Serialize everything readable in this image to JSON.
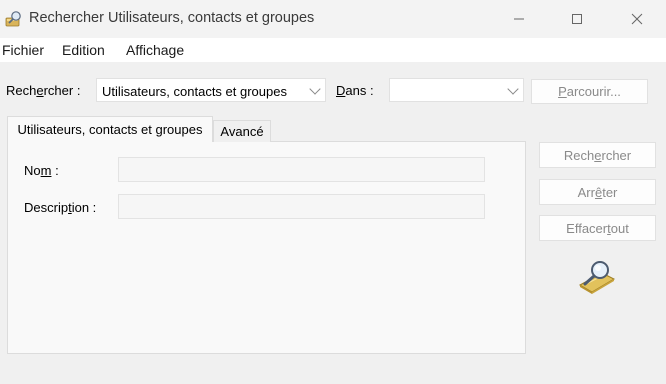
{
  "window": {
    "title": "Rechercher Utilisateurs, contacts et groupes",
    "app_icon": "find-users-icon",
    "controls": [
      "minimize-icon",
      "maximize-icon",
      "close-icon"
    ]
  },
  "menu": {
    "fichier": "Fichier",
    "edition": "Edition",
    "affichage": "Affichage"
  },
  "search_row": {
    "find_label_pre": "Rech",
    "find_label_key": "e",
    "find_label_post": "rcher :",
    "find_value": "Utilisateurs, contacts et groupes",
    "in_label_key": "D",
    "in_label_post": "ans :",
    "in_value": "",
    "browse_key": "P",
    "browse_post": "arcourir..."
  },
  "tabs": {
    "users": "Utilisateurs, contacts et groupes",
    "advanced": "Avancé"
  },
  "form": {
    "name_pre": "No",
    "name_key": "m",
    "name_post": " :",
    "name_value": "",
    "desc_pre": "Descrip",
    "desc_key": "t",
    "desc_post": "ion :",
    "desc_value": ""
  },
  "actions": {
    "search_pre": "Rech",
    "search_key": "e",
    "search_post": "rcher",
    "stop_pre": "Arr",
    "stop_key": "ê",
    "stop_post": "ter",
    "clear_pre": "Effacer ",
    "clear_key": "t",
    "clear_post": "out"
  },
  "colors": {
    "window_bg": "#f0f0f0",
    "menubar_bg": "#ffffff",
    "disabled_text": "#8a8a8a"
  }
}
